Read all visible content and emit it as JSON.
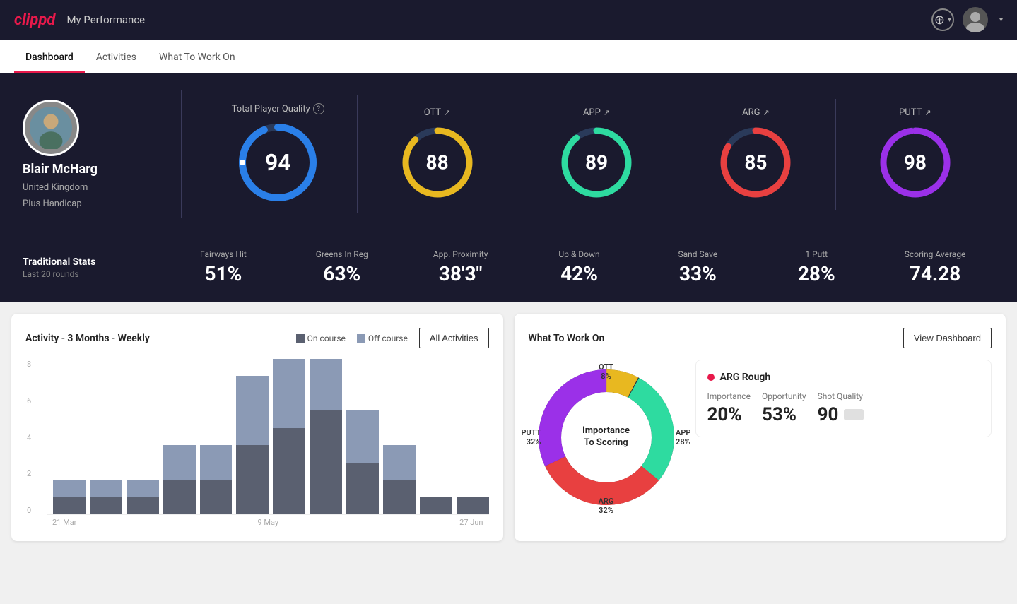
{
  "header": {
    "logo": "clippd",
    "title": "My Performance",
    "add_button_label": "+",
    "dropdown_arrow": "▾"
  },
  "nav": {
    "tabs": [
      {
        "id": "dashboard",
        "label": "Dashboard",
        "active": true
      },
      {
        "id": "activities",
        "label": "Activities",
        "active": false
      },
      {
        "id": "what-to-work-on",
        "label": "What To Work On",
        "active": false
      }
    ]
  },
  "player": {
    "name": "Blair McHarg",
    "country": "United Kingdom",
    "handicap": "Plus Handicap"
  },
  "quality": {
    "section_label": "Total Player Quality",
    "help_icon": "?",
    "total": {
      "value": "94",
      "color": "#2a7fe8"
    },
    "cards": [
      {
        "label": "OTT",
        "value": "88",
        "color": "#e8b820",
        "pct": 88
      },
      {
        "label": "APP",
        "value": "89",
        "color": "#2edba0",
        "pct": 89
      },
      {
        "label": "ARG",
        "value": "85",
        "color": "#e84040",
        "pct": 85
      },
      {
        "label": "PUTT",
        "value": "98",
        "color": "#9b30e8",
        "pct": 98
      }
    ]
  },
  "traditional_stats": {
    "title": "Traditional Stats",
    "subtitle": "Last 20 rounds",
    "stats": [
      {
        "label": "Fairways Hit",
        "value": "51%"
      },
      {
        "label": "Greens In Reg",
        "value": "63%"
      },
      {
        "label": "App. Proximity",
        "value": "38'3\""
      },
      {
        "label": "Up & Down",
        "value": "42%"
      },
      {
        "label": "Sand Save",
        "value": "33%"
      },
      {
        "label": "1 Putt",
        "value": "28%"
      },
      {
        "label": "Scoring Average",
        "value": "74.28"
      }
    ]
  },
  "activity_chart": {
    "title": "Activity - 3 Months - Weekly",
    "legend": [
      {
        "label": "On course",
        "color": "#5a6070"
      },
      {
        "label": "Off course",
        "color": "#8b9ab5"
      }
    ],
    "all_activities_btn": "All Activities",
    "y_labels": [
      "0",
      "2",
      "4",
      "6",
      "8"
    ],
    "x_labels": [
      "21 Mar",
      "9 May",
      "27 Jun"
    ],
    "bars": [
      {
        "on": 1,
        "off": 1
      },
      {
        "on": 1,
        "off": 1
      },
      {
        "on": 1,
        "off": 1
      },
      {
        "on": 2,
        "off": 2
      },
      {
        "on": 2,
        "off": 2
      },
      {
        "on": 4,
        "off": 4
      },
      {
        "on": 5,
        "off": 4
      },
      {
        "on": 6,
        "off": 3
      },
      {
        "on": 3,
        "off": 3
      },
      {
        "on": 2,
        "off": 2
      },
      {
        "on": 1,
        "off": 0
      },
      {
        "on": 1,
        "off": 0
      }
    ]
  },
  "what_to_work_on": {
    "title": "What To Work On",
    "view_dashboard_btn": "View Dashboard",
    "donut_label_line1": "Importance",
    "donut_label_line2": "To Scoring",
    "segments": [
      {
        "label": "OTT",
        "pct": "8%",
        "color": "#e8b820",
        "pct_num": 8
      },
      {
        "label": "APP",
        "pct": "28%",
        "color": "#2edba0",
        "pct_num": 28
      },
      {
        "label": "ARG",
        "pct": "32%",
        "color": "#e84040",
        "pct_num": 32
      },
      {
        "label": "PUTT",
        "pct": "32%",
        "color": "#9b30e8",
        "pct_num": 32
      }
    ],
    "info_card": {
      "dot_color": "#e8194b",
      "name": "ARG Rough",
      "metrics": [
        {
          "label": "Importance",
          "value": "20%"
        },
        {
          "label": "Opportunity",
          "value": "53%"
        },
        {
          "label": "Shot Quality",
          "value": "90",
          "has_badge": true
        }
      ]
    }
  }
}
